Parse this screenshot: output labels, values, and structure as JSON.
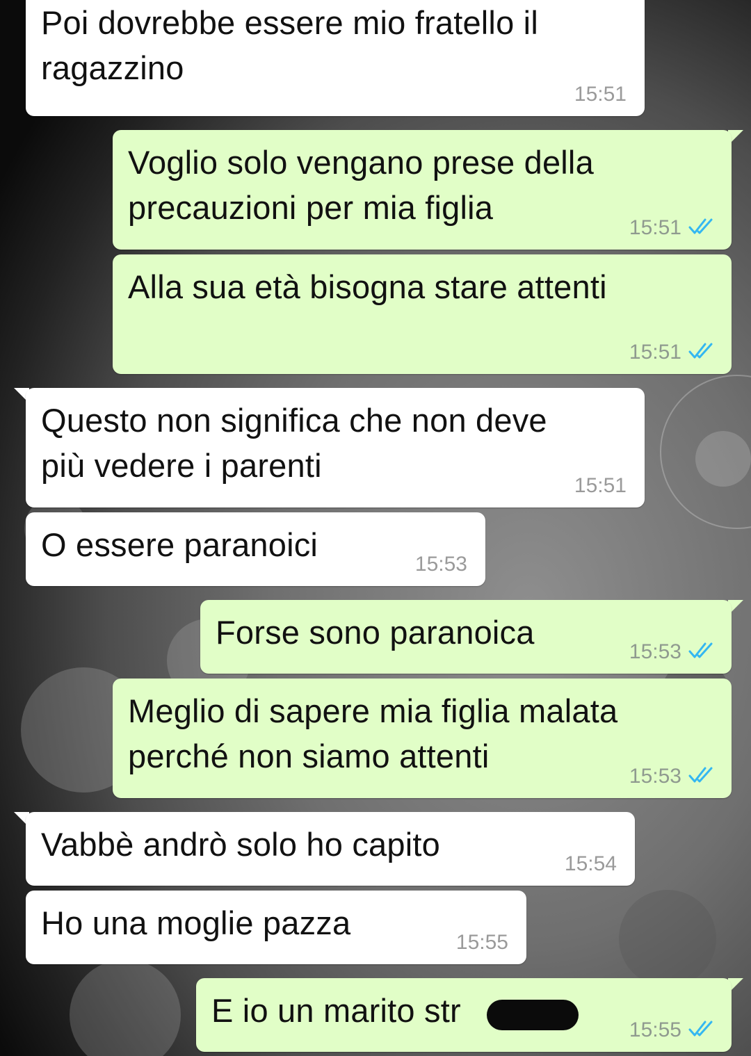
{
  "chat": {
    "messages": [
      {
        "direction": "in",
        "text": "Poi dovrebbe essere mio fratello il\nragazzino",
        "time": "15:51"
      },
      {
        "direction": "out",
        "text": "Voglio solo vengano prese della\nprecauzioni per mia figlia",
        "time": "15:51",
        "status": "read"
      },
      {
        "direction": "out",
        "text": "Alla sua età bisogna stare attenti",
        "time": "15:51",
        "status": "read"
      },
      {
        "direction": "in",
        "text": "Questo non significa che non deve\npiù vedere i parenti",
        "time": "15:51"
      },
      {
        "direction": "in",
        "text": "O essere paranoici",
        "time": "15:53"
      },
      {
        "direction": "out",
        "text": "Forse sono paranoica",
        "time": "15:53",
        "status": "read"
      },
      {
        "direction": "out",
        "text": "Meglio di sapere mia figlia malata\nperché non siamo attenti",
        "time": "15:53",
        "status": "read"
      },
      {
        "direction": "in",
        "text": "Vabbè andrò solo ho capito",
        "time": "15:54"
      },
      {
        "direction": "in",
        "text": "Ho una moglie pazza",
        "time": "15:55"
      },
      {
        "direction": "out",
        "text": "E io un marito str",
        "time": "15:55",
        "status": "read"
      }
    ]
  },
  "colors": {
    "incoming_bubble": "#ffffff",
    "outgoing_bubble": "#e1fec7",
    "read_ticks": "#34b7f1",
    "timestamp": "#9a9a9a"
  },
  "icons": {
    "read_status": "double-check-icon",
    "redaction": "redaction-mark"
  }
}
